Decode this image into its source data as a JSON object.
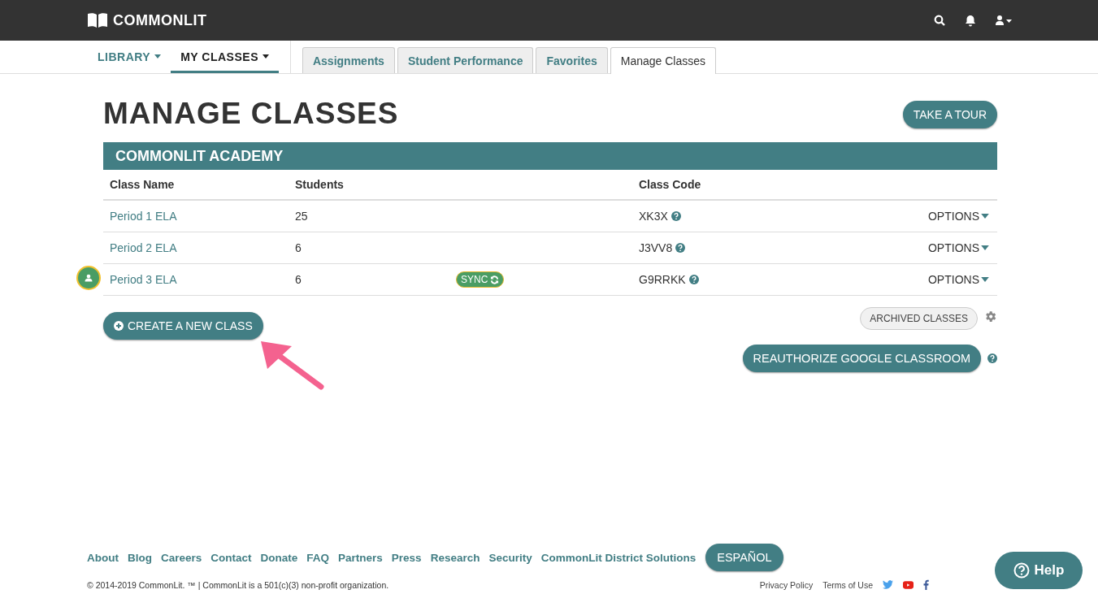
{
  "header": {
    "logo": "COMMONLIT"
  },
  "nav": {
    "menus": [
      {
        "label": "LIBRARY",
        "selected": false
      },
      {
        "label": "MY CLASSES",
        "selected": true
      }
    ],
    "tabs": [
      {
        "label": "Assignments",
        "selected": false
      },
      {
        "label": "Student Performance",
        "selected": false
      },
      {
        "label": "Favorites",
        "selected": false
      },
      {
        "label": "Manage Classes",
        "selected": true
      }
    ]
  },
  "page": {
    "title": "MANAGE CLASSES",
    "tour_button": "TAKE A TOUR"
  },
  "school": {
    "name": "COMMONLIT ACADEMY",
    "columns": [
      "Class Name",
      "Students",
      "Class Code"
    ],
    "rows": [
      {
        "name": "Period 1 ELA",
        "students": "25",
        "code": "XK3X",
        "options": "OPTIONS",
        "google_linked": false
      },
      {
        "name": "Period 2 ELA",
        "students": "6",
        "code": "J3VV8",
        "options": "OPTIONS",
        "google_linked": false
      },
      {
        "name": "Period 3 ELA",
        "students": "6",
        "sync": "SYNC",
        "code": "G9RRKK",
        "options": "OPTIONS",
        "google_linked": true
      }
    ]
  },
  "actions": {
    "create": "CREATE A NEW CLASS",
    "archived": "ARCHIVED CLASSES",
    "reauthorize": "REAUTHORIZE GOOGLE CLASSROOM"
  },
  "footer": {
    "links": [
      "About",
      "Blog",
      "Careers",
      "Contact",
      "Donate",
      "FAQ",
      "Partners",
      "Press",
      "Research",
      "Security",
      "CommonLit District Solutions"
    ],
    "language_button": "ESPAÑOL",
    "copyright": "© 2014-2019 CommonLit. ™ | CommonLit is a 501(c)(3) non-profit organization.",
    "legal": [
      "Privacy Policy",
      "Terms of Use"
    ]
  },
  "help_button": "Help"
}
